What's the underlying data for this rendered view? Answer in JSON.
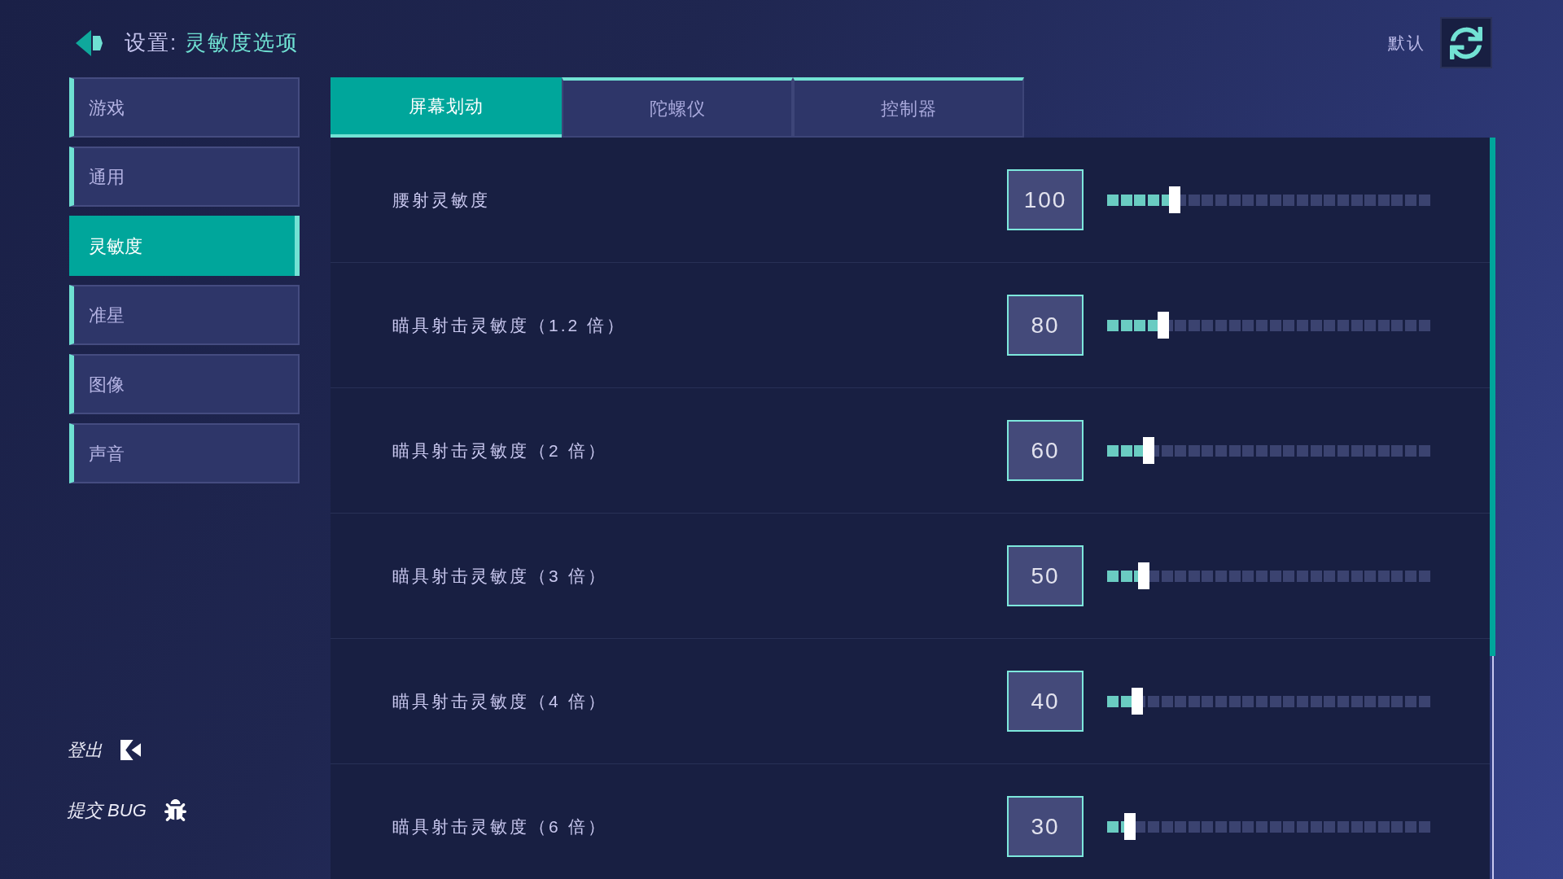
{
  "header": {
    "section": "设置:",
    "page": "灵敏度选项"
  },
  "reset": {
    "label": "默认"
  },
  "sidebar": {
    "items": [
      {
        "label": "游戏",
        "selected": false
      },
      {
        "label": "通用",
        "selected": false
      },
      {
        "label": "灵敏度",
        "selected": true
      },
      {
        "label": "准星",
        "selected": false
      },
      {
        "label": "图像",
        "selected": false
      },
      {
        "label": "声音",
        "selected": false
      }
    ],
    "links": [
      {
        "kind": "logout",
        "label": "登出"
      },
      {
        "kind": "bug",
        "label": "提交 BUG"
      }
    ]
  },
  "tabs": [
    {
      "label": "屏幕划动",
      "selected": true
    },
    {
      "label": "陀螺仪",
      "selected": false
    },
    {
      "label": "控制器",
      "selected": false
    }
  ],
  "rows": [
    {
      "label": "腰射灵敏度",
      "value": "100",
      "level": 0.21
    },
    {
      "label": "瞄具射击灵敏度（1.2 倍）",
      "value": "80",
      "level": 0.174
    },
    {
      "label": "瞄具射击灵敏度（2 倍）",
      "value": "60",
      "level": 0.128
    },
    {
      "label": "瞄具射击灵敏度（3 倍）",
      "value": "50",
      "level": 0.113
    },
    {
      "label": "瞄具射击灵敏度（4 倍）",
      "value": "40",
      "level": 0.092
    },
    {
      "label": "瞄具射击灵敏度（6 倍）",
      "value": "30",
      "level": 0.07
    }
  ]
}
